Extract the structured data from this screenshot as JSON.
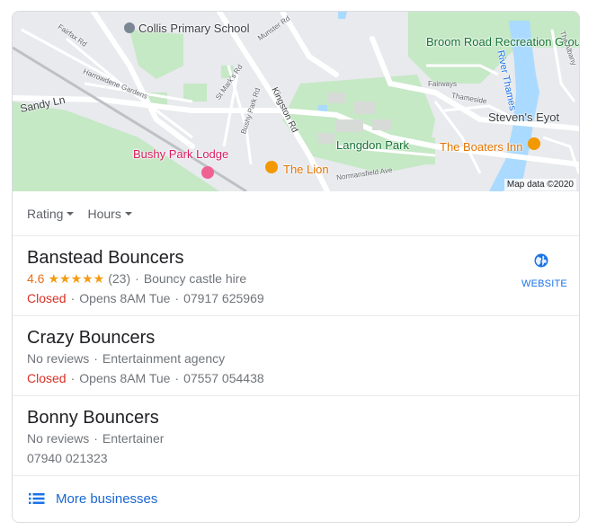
{
  "map": {
    "labels": {
      "school": "Collis Primary School",
      "park_recreation": "Broom Road Recreation Ground",
      "river": "River Thames",
      "eyot": "Steven's Eyot",
      "langdon": "Langdon Park",
      "boaters": "The Boaters Inn",
      "lodge": "Bushy Park Lodge",
      "lion": "The Lion",
      "sandy": "Sandy Ln",
      "fairfax": "Fairfax Rd",
      "munster": "Munster Rd",
      "harrowdene": "Harrowdene Gardens",
      "stmarks": "St Mark's Rd",
      "bushypark": "Bushy Park Rd",
      "kingston": "Kingston Rd",
      "fairways": "Fairways",
      "thameside": "Thameside",
      "mansfield": "Normansfield Ave",
      "albany": "The Albany"
    },
    "attribution": "Map data ©2020"
  },
  "filters": [
    {
      "label": "Rating"
    },
    {
      "label": "Hours"
    }
  ],
  "results": [
    {
      "name": "Banstead Bouncers",
      "rating": "4.6",
      "stars": "★★★★★",
      "reviews": "(23)",
      "category": "Bouncy castle hire",
      "status": "Closed",
      "opens": "Opens 8AM Tue",
      "phone": "07917 625969",
      "website_label": "WEBSITE"
    },
    {
      "name": "Crazy Bouncers",
      "reviews": "No reviews",
      "category": "Entertainment agency",
      "status": "Closed",
      "opens": "Opens 8AM Tue",
      "phone": "07557 054438"
    },
    {
      "name": "Bonny Bouncers",
      "reviews": "No reviews",
      "category": "Entertainer",
      "phone": "07940 021323"
    }
  ],
  "more": {
    "label": "More businesses"
  },
  "colors": {
    "accent": "#1a73e8",
    "closed": "#d93025",
    "rating": "#e7711b"
  }
}
